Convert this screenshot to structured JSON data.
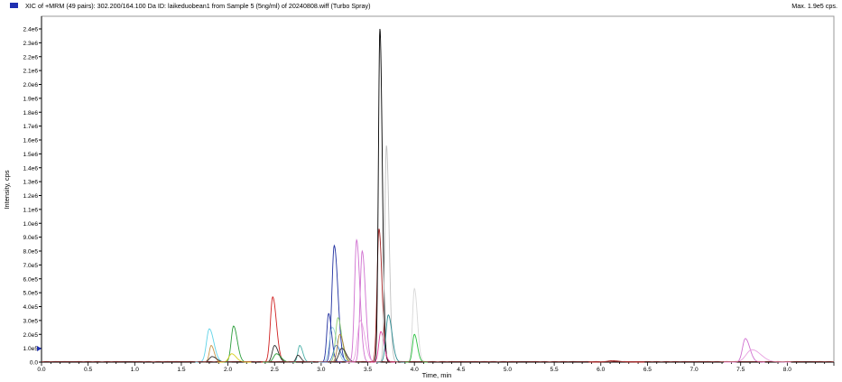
{
  "header": {
    "title": "XIC of +MRM (49 pairs): 302.200/164.100 Da ID: laikeduobean1 from Sample 5 (5ng/ml) of 20240808.wiff (Turbo Spray)",
    "max_label": "Max. 1.9e5 cps.",
    "legend_color": "#1f2fb0"
  },
  "chart_data": {
    "type": "line",
    "xlabel": "Time, min",
    "ylabel": "Intensity, cps",
    "xlim": [
      0,
      8.5
    ],
    "ylim": [
      0,
      2400000
    ],
    "x_ticks": [
      "0.0",
      "0.5",
      "1.0",
      "1.5",
      "2.0",
      "2.5",
      "3.0",
      "3.5",
      "4.0",
      "4.5",
      "5.0",
      "5.5",
      "6.0",
      "6.5",
      "7.0",
      "7.5",
      "8.0"
    ],
    "y_ticks": [
      "0.0",
      "1.0e5",
      "2.0e5",
      "3.0e5",
      "4.0e5",
      "5.0e5",
      "6.0e5",
      "7.0e5",
      "8.0e5",
      "9.0e5",
      "1.0e6",
      "1.1e6",
      "1.2e6",
      "1.3e6",
      "1.4e6",
      "1.5e6",
      "1.6e6",
      "1.7e6",
      "1.8e6",
      "1.9e6",
      "2.0e6",
      "2.1e6",
      "2.2e6",
      "2.3e6",
      "2.4e6"
    ],
    "grid": false,
    "peaks": [
      {
        "color": "#5fd3e8",
        "rt": 1.8,
        "height": 240000,
        "width": 0.03
      },
      {
        "color": "#c8964a",
        "rt": 1.82,
        "height": 120000,
        "width": 0.02
      },
      {
        "color": "#303030",
        "rt": 1.83,
        "height": 40000,
        "width": 0.03
      },
      {
        "color": "#2a9d3a",
        "rt": 2.06,
        "height": 260000,
        "width": 0.025
      },
      {
        "color": "#d8d020",
        "rt": 2.04,
        "height": 60000,
        "width": 0.03
      },
      {
        "color": "#d02020",
        "rt": 2.48,
        "height": 470000,
        "width": 0.025
      },
      {
        "color": "#303030",
        "rt": 2.5,
        "height": 120000,
        "width": 0.025
      },
      {
        "color": "#2a9d3a",
        "rt": 2.52,
        "height": 60000,
        "width": 0.03
      },
      {
        "color": "#4ab0a8",
        "rt": 2.77,
        "height": 120000,
        "width": 0.02
      },
      {
        "color": "#303030",
        "rt": 2.75,
        "height": 50000,
        "width": 0.02
      },
      {
        "color": "#2030a0",
        "rt": 3.08,
        "height": 350000,
        "width": 0.02
      },
      {
        "color": "#2030a0",
        "rt": 3.14,
        "height": 840000,
        "width": 0.025
      },
      {
        "color": "#9ad0e0",
        "rt": 3.12,
        "height": 250000,
        "width": 0.03
      },
      {
        "color": "#90d070",
        "rt": 3.18,
        "height": 320000,
        "width": 0.025
      },
      {
        "color": "#4a7ac8",
        "rt": 3.16,
        "height": 120000,
        "width": 0.03
      },
      {
        "color": "#b08040",
        "rt": 3.2,
        "height": 200000,
        "width": 0.025
      },
      {
        "color": "#303030",
        "rt": 3.22,
        "height": 100000,
        "width": 0.03
      },
      {
        "color": "#d070d0",
        "rt": 3.38,
        "height": 880000,
        "width": 0.022
      },
      {
        "color": "#d070d0",
        "rt": 3.44,
        "height": 800000,
        "width": 0.022
      },
      {
        "color": "#e8a0e0",
        "rt": 3.42,
        "height": 300000,
        "width": 0.03
      },
      {
        "color": "#a02020",
        "rt": 3.62,
        "height": 960000,
        "width": 0.02
      },
      {
        "color": "#000000",
        "rt": 3.63,
        "height": 2400000,
        "width": 0.016
      },
      {
        "color": "#e040a0",
        "rt": 3.64,
        "height": 220000,
        "width": 0.022
      },
      {
        "color": "#c0c0c0",
        "rt": 3.7,
        "height": 1560000,
        "width": 0.018
      },
      {
        "color": "#2a8a90",
        "rt": 3.72,
        "height": 340000,
        "width": 0.025
      },
      {
        "color": "#d8d8d8",
        "rt": 4.0,
        "height": 530000,
        "width": 0.02
      },
      {
        "color": "#2ac040",
        "rt": 4.0,
        "height": 200000,
        "width": 0.02
      },
      {
        "color": "#a02020",
        "rt": 6.12,
        "height": 10000,
        "width": 0.05
      },
      {
        "color": "#d070d0",
        "rt": 7.55,
        "height": 170000,
        "width": 0.03
      },
      {
        "color": "#e8a0e0",
        "rt": 7.62,
        "height": 90000,
        "width": 0.06
      }
    ]
  }
}
